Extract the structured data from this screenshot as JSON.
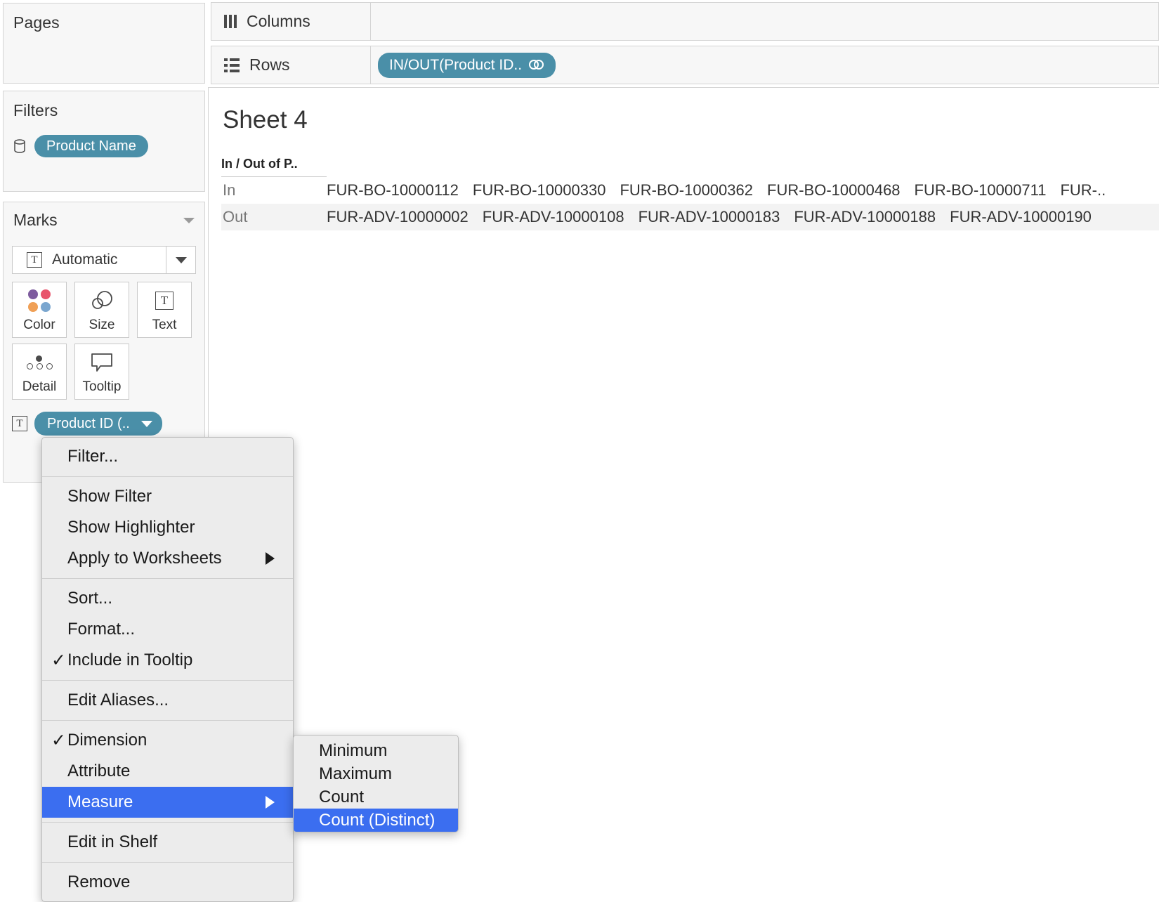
{
  "app": "Tableau",
  "left_panel": {
    "pages": {
      "title": "Pages"
    },
    "filters": {
      "title": "Filters",
      "icon": "database-icon",
      "pills": [
        {
          "label": "Product Name"
        }
      ]
    },
    "marks": {
      "title": "Marks",
      "collapse_icon": "chevron-down-icon",
      "mark_type": {
        "label": "Automatic",
        "icon": "text-mark-icon",
        "dropdown_icon": "caret-down-icon"
      },
      "buttons": [
        {
          "label": "Color",
          "icon": "color-dots-icon"
        },
        {
          "label": "Size",
          "icon": "size-circles-icon"
        },
        {
          "label": "Text",
          "icon": "text-box-icon"
        },
        {
          "label": "Detail",
          "icon": "detail-dots-icon"
        },
        {
          "label": "Tooltip",
          "icon": "tooltip-bubble-icon"
        }
      ],
      "color_swatches": [
        "#7d5b9e",
        "#e8546c",
        "#f0a056",
        "#7aa6cf"
      ],
      "pill": {
        "label": "Product ID (..",
        "icon": "text-mark-icon",
        "caret": "caret-down-icon"
      }
    }
  },
  "shelves": {
    "columns": {
      "label": "Columns",
      "icon": "columns-icon",
      "pills": []
    },
    "rows": {
      "label": "Rows",
      "icon": "rows-icon",
      "pills": [
        {
          "label": "IN/OUT(Product ID..",
          "icon": "set-link-icon"
        }
      ]
    }
  },
  "worksheet": {
    "title": "Sheet 4",
    "field_header": "In / Out of P..",
    "rows": [
      {
        "label": "In",
        "values": [
          "FUR-BO-10000112",
          "FUR-BO-10000330",
          "FUR-BO-10000362",
          "FUR-BO-10000468",
          "FUR-BO-10000711",
          "FUR-.."
        ]
      },
      {
        "label": "Out",
        "values": [
          "FUR-ADV-10000002",
          "FUR-ADV-10000108",
          "FUR-ADV-10000183",
          "FUR-ADV-10000188",
          "FUR-ADV-10000190"
        ]
      }
    ]
  },
  "context_menu": {
    "items": [
      {
        "label": "Filter...",
        "checked": false,
        "submenu": false,
        "selected": false
      },
      {
        "label": "Show Filter",
        "checked": false,
        "submenu": false,
        "selected": false
      },
      {
        "label": "Show Highlighter",
        "checked": false,
        "submenu": false,
        "selected": false
      },
      {
        "label": "Apply to Worksheets",
        "checked": false,
        "submenu": true,
        "selected": false
      },
      {
        "label": "Sort...",
        "checked": false,
        "submenu": false,
        "selected": false
      },
      {
        "label": "Format...",
        "checked": false,
        "submenu": false,
        "selected": false
      },
      {
        "label": "Include in Tooltip",
        "checked": true,
        "submenu": false,
        "selected": false
      },
      {
        "label": "Edit Aliases...",
        "checked": false,
        "submenu": false,
        "selected": false
      },
      {
        "label": "Dimension",
        "checked": true,
        "submenu": false,
        "selected": false
      },
      {
        "label": "Attribute",
        "checked": false,
        "submenu": false,
        "selected": false
      },
      {
        "label": "Measure",
        "checked": false,
        "submenu": true,
        "selected": true
      },
      {
        "label": "Edit in Shelf",
        "checked": false,
        "submenu": false,
        "selected": false
      },
      {
        "label": "Remove",
        "checked": false,
        "submenu": false,
        "selected": false
      }
    ],
    "check_glyph": "✓"
  },
  "submenu": {
    "items": [
      {
        "label": "Minimum",
        "selected": false
      },
      {
        "label": "Maximum",
        "selected": false
      },
      {
        "label": "Count",
        "selected": false
      },
      {
        "label": "Count (Distinct)",
        "selected": true
      }
    ]
  },
  "colors": {
    "pill_teal": "#4a8fa8",
    "menu_highlight": "#3b6ef0",
    "menu_bg": "#ececec",
    "panel_bg": "#f7f7f7"
  }
}
